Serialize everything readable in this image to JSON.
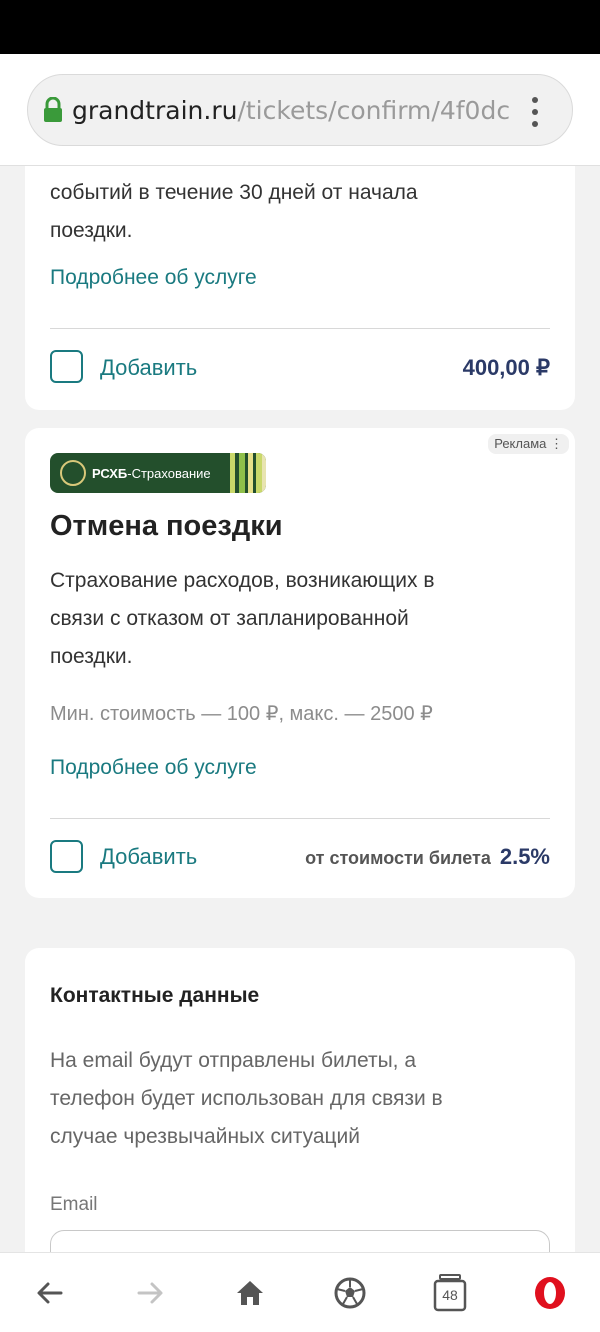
{
  "browser": {
    "url_domain": "grandtrain.ru",
    "url_path": "/tickets/confirm/4f0dc",
    "tabs_count": "48"
  },
  "card1": {
    "description_tail_line1": "событий в течение 30 дней от начала",
    "description_tail_line2": "поездки.",
    "more_link": "Подробнее об услуге",
    "add_label": "Добавить",
    "price": "400,00 ₽"
  },
  "card2": {
    "ad_badge": "Реклама",
    "logo_brand": "РСХБ",
    "logo_suffix": "-Страхование",
    "title": "Отмена поездки",
    "description_line1": "Страхование расходов, возникающих в",
    "description_line2": "связи с отказом от запланированной",
    "description_line3": "поездки.",
    "cost_range": "Мин. стоимость — 100 ₽, макс. — 2500 ₽",
    "more_link": "Подробнее об услуге",
    "add_label": "Добавить",
    "price_prefix": "от стоимости билета",
    "price_value": "2.5%"
  },
  "contacts": {
    "title": "Контактные данные",
    "description_line1": "На email будут отправлены билеты, а",
    "description_line2": "телефон будет использован для связи в",
    "description_line3": "случае чрезвычайных ситуаций",
    "email_label": "Email"
  },
  "colors": {
    "accent": "#1a7a80",
    "price": "#2b3a67",
    "brand_green": "#234f2c",
    "opera_red": "#e0101e"
  },
  "nav_icons": [
    "back-arrow-icon",
    "forward-arrow-icon",
    "home-icon",
    "soccer-ball-icon",
    "tabs-icon",
    "opera-menu-icon"
  ]
}
